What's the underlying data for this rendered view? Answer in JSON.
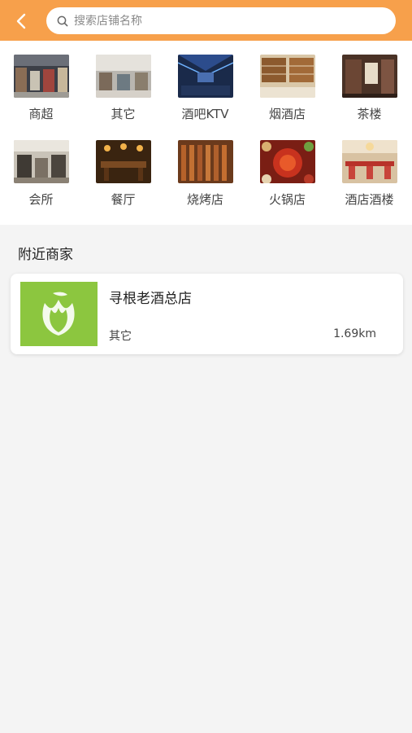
{
  "header": {
    "search_placeholder": "搜索店铺名称"
  },
  "categories": [
    {
      "label": "商超"
    },
    {
      "label": "其它"
    },
    {
      "label": "酒吧KTV"
    },
    {
      "label": "烟酒店"
    },
    {
      "label": "茶楼"
    },
    {
      "label": "会所"
    },
    {
      "label": "餐厅"
    },
    {
      "label": "烧烤店"
    },
    {
      "label": "火锅店"
    },
    {
      "label": "酒店酒楼"
    }
  ],
  "nearby": {
    "title": "附近商家",
    "merchants": [
      {
        "name": "寻根老酒总店",
        "category": "其它",
        "distance": "1.69km"
      }
    ]
  },
  "colors": {
    "header": "#f7a04b",
    "logo_green": "#8cc63f"
  }
}
